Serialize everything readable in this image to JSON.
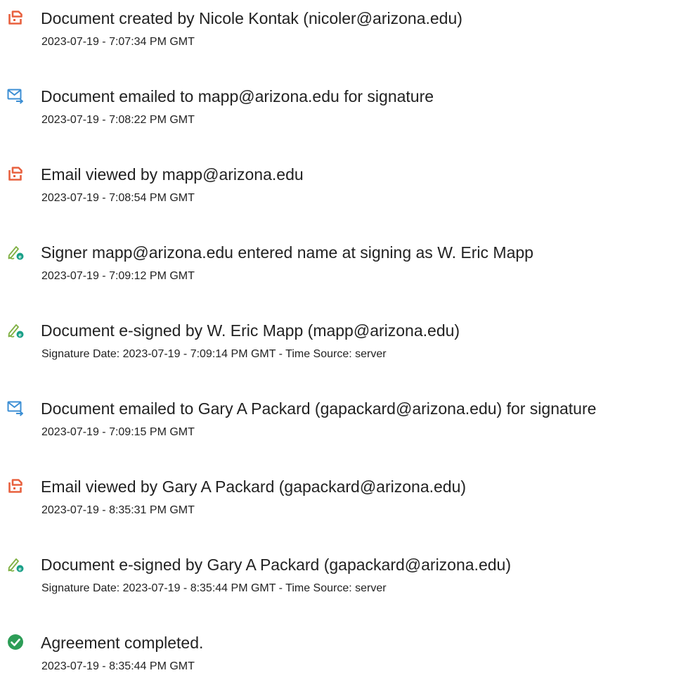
{
  "colors": {
    "document_icon": "#e8613f",
    "email_icon": "#3d8fd4",
    "sign_icon_pen": "#7fb043",
    "sign_icon_badge": "#1aa088",
    "complete_icon": "#2d9d57"
  },
  "events": [
    {
      "icon": "document-icon",
      "title": "Document created by Nicole Kontak (nicoler@arizona.edu)",
      "subtitle": "2023-07-19 - 7:07:34 PM GMT"
    },
    {
      "icon": "email-icon",
      "title": "Document emailed to mapp@arizona.edu for signature",
      "subtitle": "2023-07-19 - 7:08:22 PM GMT"
    },
    {
      "icon": "document-icon",
      "title": "Email viewed by mapp@arizona.edu",
      "subtitle": "2023-07-19 - 7:08:54 PM GMT"
    },
    {
      "icon": "signature-icon",
      "title": "Signer mapp@arizona.edu entered name at signing as W. Eric Mapp",
      "subtitle": "2023-07-19 - 7:09:12 PM GMT"
    },
    {
      "icon": "signature-icon",
      "title": "Document e-signed by W. Eric Mapp (mapp@arizona.edu)",
      "subtitle": "Signature Date: 2023-07-19 - 7:09:14 PM GMT - Time Source: server"
    },
    {
      "icon": "email-icon",
      "title": "Document emailed to Gary A Packard (gapackard@arizona.edu) for signature",
      "subtitle": "2023-07-19 - 7:09:15 PM GMT"
    },
    {
      "icon": "document-icon",
      "title": "Email viewed by Gary A Packard (gapackard@arizona.edu)",
      "subtitle": "2023-07-19 - 8:35:31 PM GMT"
    },
    {
      "icon": "signature-icon",
      "title": "Document e-signed by Gary A Packard (gapackard@arizona.edu)",
      "subtitle": "Signature Date: 2023-07-19 - 8:35:44 PM GMT - Time Source: server"
    },
    {
      "icon": "checkmark-circle-icon",
      "title": "Agreement completed.",
      "subtitle": "2023-07-19 - 8:35:44 PM GMT"
    }
  ]
}
